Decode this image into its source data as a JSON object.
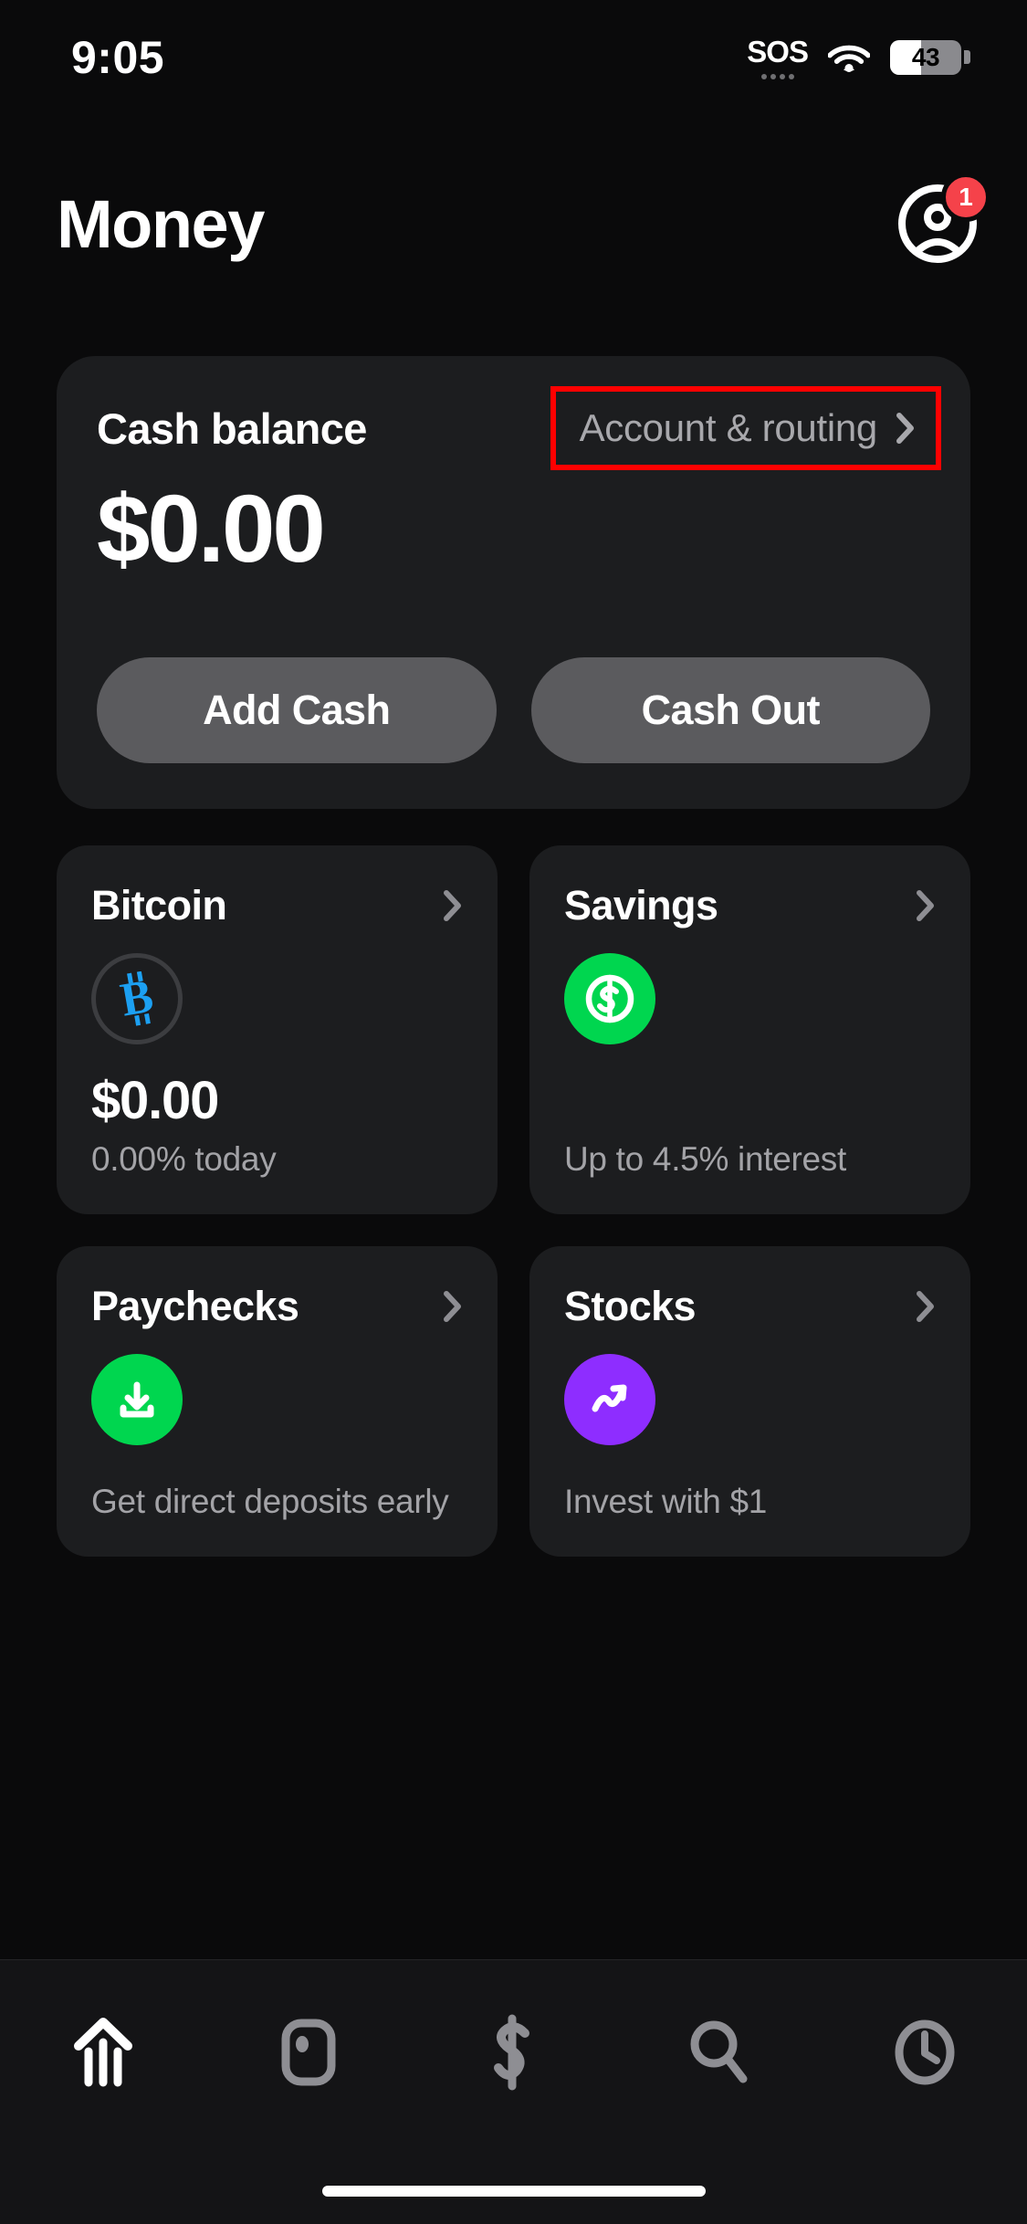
{
  "status_bar": {
    "time": "9:05",
    "sos_label": "SOS",
    "wifi_icon": "wifi-icon",
    "battery": {
      "percent": "43",
      "level": 43
    }
  },
  "header": {
    "title": "Money",
    "avatar_icon": "profile-avatar-icon",
    "notification_count": "1"
  },
  "balance_card": {
    "label": "Cash balance",
    "account_routing": {
      "label": "Account & routing",
      "chevron_icon": "chevron-right-icon",
      "highlighted": true
    },
    "amount": "$0.00",
    "buttons": [
      {
        "label": "Add Cash",
        "name": "add-cash-button"
      },
      {
        "label": "Cash Out",
        "name": "cash-out-button"
      }
    ]
  },
  "tiles": [
    {
      "title": "Bitcoin",
      "icon": "bitcoin-icon",
      "value": "$0.00",
      "subtitle": "0.00% today",
      "chevron_icon": "chevron-right-icon"
    },
    {
      "title": "Savings",
      "icon": "savings-dollar-circle-icon",
      "value": "",
      "subtitle": "Up to 4.5% interest",
      "chevron_icon": "chevron-right-icon"
    },
    {
      "title": "Paychecks",
      "icon": "direct-deposit-download-icon",
      "value": "",
      "subtitle": "Get direct deposits early",
      "chevron_icon": "chevron-right-icon"
    },
    {
      "title": "Stocks",
      "icon": "stocks-trend-arrow-icon",
      "value": "",
      "subtitle": "Invest with $1",
      "chevron_icon": "chevron-right-icon"
    }
  ],
  "tabbar": [
    {
      "name": "tab-banking",
      "icon": "banking-arrow-icon",
      "active": true
    },
    {
      "name": "tab-card",
      "icon": "card-icon",
      "active": false
    },
    {
      "name": "tab-payments",
      "icon": "dollar-sign-icon",
      "active": false
    },
    {
      "name": "tab-search",
      "icon": "search-icon",
      "active": false
    },
    {
      "name": "tab-activity",
      "icon": "clock-icon",
      "active": false
    }
  ],
  "colors": {
    "background": "#0a0a0b",
    "card": "#1c1d1f",
    "accent_green": "#00d64f",
    "accent_purple": "#8e2dff",
    "accent_bitcoin": "#1ca0f2",
    "badge_red": "#f5424a",
    "highlight_box": "#ff0000",
    "muted_text": "#a3a3a7",
    "pill_button": "#5b5b5e"
  }
}
